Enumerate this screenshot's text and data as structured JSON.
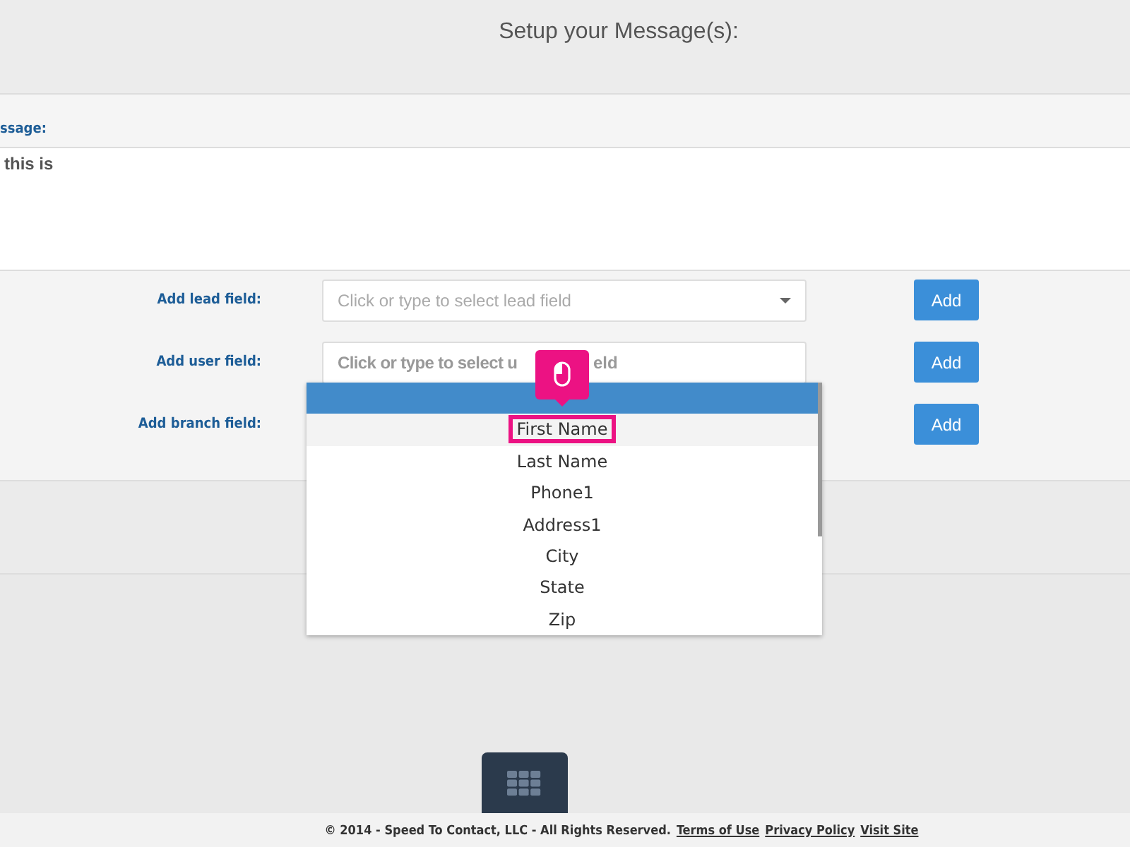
{
  "header": {
    "title": "Setup your Message(s):"
  },
  "message": {
    "label": "ssage:",
    "value": "this is"
  },
  "field_rows": [
    {
      "label": "Add lead field:",
      "placeholder": "Click or type to select lead field",
      "kind": "select",
      "button": "Add"
    },
    {
      "label": "Add user field:",
      "value": "Click or type to select u",
      "value_end": "eld",
      "kind": "open",
      "button": "Add"
    },
    {
      "label": "Add branch field:",
      "kind": "empty",
      "button": "Add"
    }
  ],
  "dropdown": {
    "options": [
      {
        "selected": true,
        "clicked": false
      },
      {
        "label": "First Name",
        "selected": false,
        "clicked": true
      },
      {
        "label": "Last Name",
        "selected": false,
        "clicked": false
      },
      {
        "label": "Phone1",
        "selected": false,
        "clicked": false
      },
      {
        "label": "Address1",
        "selected": false,
        "clicked": false
      },
      {
        "label": "City",
        "selected": false,
        "clicked": false
      },
      {
        "label": "State",
        "selected": false,
        "clicked": false
      },
      {
        "label": "Zip",
        "selected": false,
        "clicked": false
      }
    ]
  },
  "footer": {
    "text": "© 2014 - Speed To Contact, LLC - All Rights Reserved.",
    "links": [
      "Terms of Use",
      "Privacy Policy",
      "Visit Site"
    ]
  }
}
